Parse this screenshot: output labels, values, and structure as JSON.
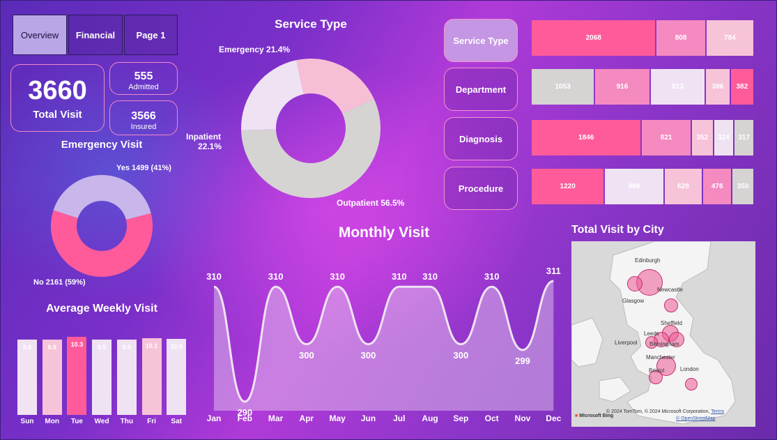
{
  "tabs": [
    {
      "label": "Overview",
      "active": true
    },
    {
      "label": "Financial",
      "active": false
    },
    {
      "label": "Page 1",
      "active": false
    }
  ],
  "kpis": {
    "total_visit_value": "3660",
    "total_visit_label": "Total Visit",
    "admitted_value": "555",
    "admitted_label": "Admitted",
    "insured_value": "3566",
    "insured_label": "Insured"
  },
  "emergency_visit": {
    "title": "Emergency Visit",
    "slices": [
      {
        "label": "Yes 1499 (41%)",
        "value": 1499,
        "percent": 41,
        "color": "#c9b6ea"
      },
      {
        "label": "No 2161 (59%)",
        "value": 2161,
        "percent": 59,
        "color": "#ff5b9a"
      }
    ]
  },
  "service_type": {
    "title": "Service Type",
    "slices": [
      {
        "label": "Emergency 21.4%",
        "percent": 21.4,
        "color": "#f7bfd6"
      },
      {
        "label": "Outpatient 56.5%",
        "percent": 56.5,
        "color": "#d6d3d3"
      },
      {
        "label_line1": "Inpatient",
        "label_line2": "22.1%",
        "percent": 22.1,
        "color": "#efe3f3"
      }
    ]
  },
  "filters": [
    {
      "label": "Service Type",
      "active": true
    },
    {
      "label": "Department",
      "active": false
    },
    {
      "label": "Diagnosis",
      "active": false
    },
    {
      "label": "Procedure",
      "active": false
    }
  ],
  "stacked_rows": [
    {
      "name": "service-type",
      "values": [
        2068,
        808,
        784
      ],
      "colors": [
        "#ff5b9a",
        "#f48ac0",
        "#f7c3d8"
      ]
    },
    {
      "name": "department",
      "values": [
        1053,
        916,
        913,
        396,
        382
      ],
      "colors": [
        "#d6d3d3",
        "#f48ac0",
        "#efe3f3",
        "#f7c3d8",
        "#ff5b9a"
      ]
    },
    {
      "name": "diagnosis",
      "values": [
        1846,
        821,
        352,
        324,
        317
      ],
      "colors": [
        "#ff5b9a",
        "#f48ac0",
        "#f7c3d8",
        "#efe3f3",
        "#d6d3d3"
      ]
    },
    {
      "name": "procedure",
      "values": [
        1220,
        986,
        628,
        476,
        350
      ],
      "colors": [
        "#ff5b9a",
        "#efe3f3",
        "#f7c3d8",
        "#f48ac0",
        "#d6d3d3"
      ]
    }
  ],
  "weekly": {
    "title": "Average Weekly Visit",
    "chart_data": {
      "type": "bar",
      "categories": [
        "Sun",
        "Mon",
        "Tue",
        "Wed",
        "Thu",
        "Fri",
        "Sat"
      ],
      "values": [
        9.9,
        9.9,
        10.3,
        9.9,
        9.9,
        10.1,
        10.0
      ],
      "value_labels": [
        "9.9",
        "9.9",
        "10.3",
        "9.9",
        "9.9",
        "10.1",
        "10.0"
      ],
      "colors": [
        "#f2e3f2",
        "#f7c3d8",
        "#ff5b9a",
        "#efe3f3",
        "#efe3f3",
        "#f7c3d8",
        "#efe3f3"
      ]
    }
  },
  "monthly": {
    "title": "Monthly Visit",
    "chart_data": {
      "type": "area",
      "categories": [
        "Jan",
        "Feb",
        "Mar",
        "Apr",
        "May",
        "Jun",
        "Jul",
        "Aug",
        "Sep",
        "Oct",
        "Nov",
        "Dec"
      ],
      "values": [
        310,
        290,
        310,
        300,
        310,
        300,
        310,
        310,
        300,
        310,
        299,
        311
      ]
    }
  },
  "city_map": {
    "title": "Total Visit by City",
    "cities": [
      {
        "name": "Edinburgh"
      },
      {
        "name": "Glasgow"
      },
      {
        "name": "Newcastle"
      },
      {
        "name": "Sheffield"
      },
      {
        "name": "Leeds"
      },
      {
        "name": "Liverpool"
      },
      {
        "name": "Birmingham"
      },
      {
        "name": "Manchester"
      },
      {
        "name": "Bristol"
      },
      {
        "name": "London"
      }
    ],
    "attribution": "© 2024 TomTom, © 2024 Microsoft Corporation,",
    "terms": "Terms",
    "osm": "© OpenStreetMap",
    "bing": "Microsoft Bing"
  }
}
